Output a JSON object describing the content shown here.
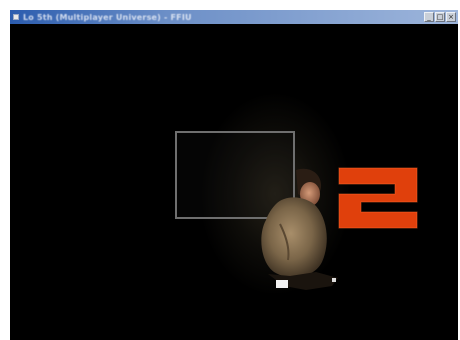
{
  "window": {
    "title": "Lo 5th (Multiplayer Universe) - FFIU",
    "controls": {
      "minimize": "_",
      "maximize": "□",
      "close": "×"
    }
  },
  "scene": {
    "level_number": "2",
    "colors": {
      "background": "#000000",
      "digit": "#e0400c",
      "frame": "#6f6f6f",
      "titlebar": "#2b5cae"
    },
    "icons": {
      "app": "app-icon",
      "character": "character-figure"
    }
  }
}
